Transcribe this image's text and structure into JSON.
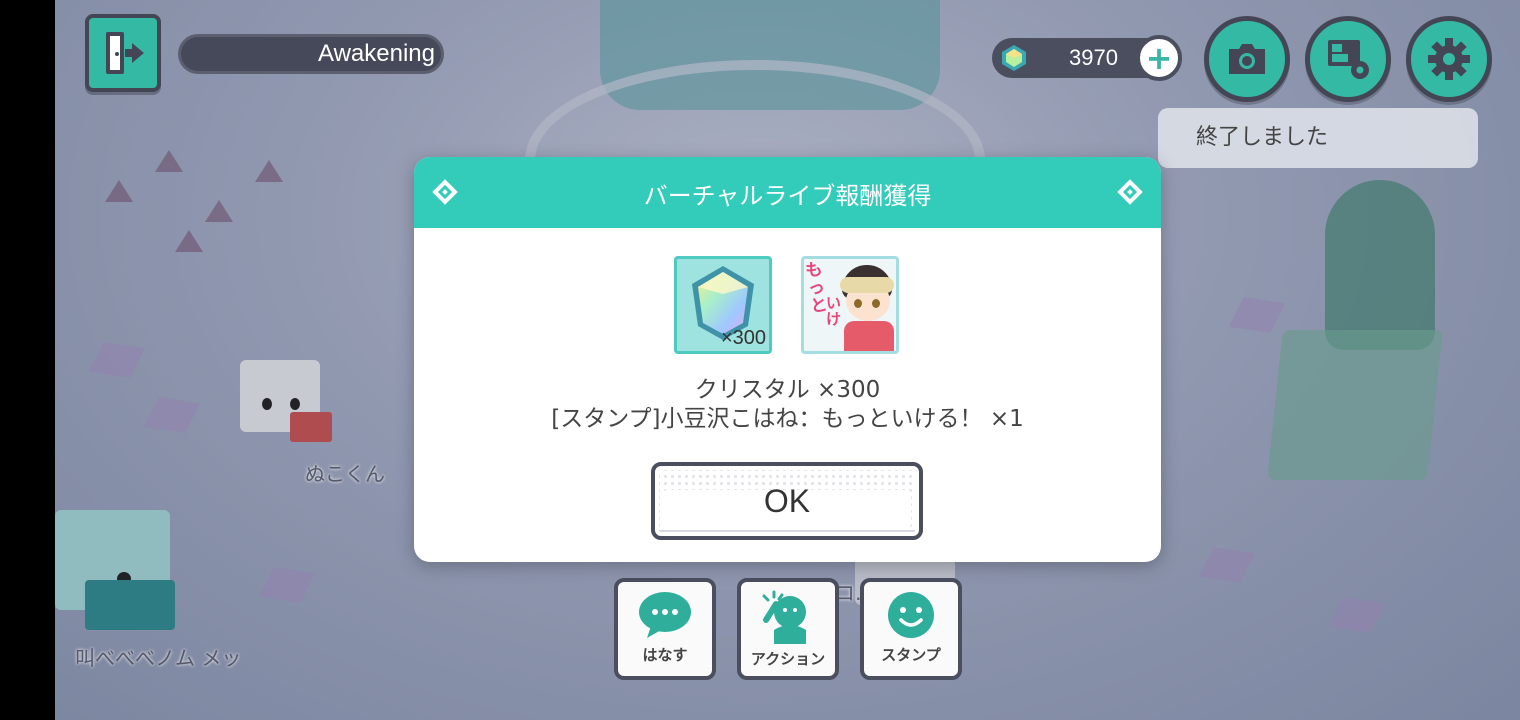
{
  "header": {
    "song_title": "Awakening",
    "crystal_count": "3970",
    "plus_label": "+"
  },
  "notice": "終了しました",
  "players": [
    {
      "name": "ぬこくん"
    },
    {
      "name": "叫べべべノム メッ"
    },
    {
      "name": "コ…きん"
    }
  ],
  "dialog": {
    "title": "バーチャルライブ報酬獲得",
    "rewards": [
      {
        "type": "crystal",
        "qty_label": "×300",
        "icon": "crystal-icon"
      },
      {
        "type": "stamp",
        "icon": "stamp-icon",
        "stamp_text": "もっといける!"
      }
    ],
    "reward_line1": "クリスタル ×300",
    "reward_line2": "[スタンプ]小豆沢こはね：もっといける！ ×1",
    "ok_label": "OK"
  },
  "bottom_bar": {
    "talk_label": "はなす",
    "action_label": "アクション",
    "stamp_label": "スタンプ"
  },
  "colors": {
    "accent": "#33ccbb",
    "button_teal": "#34b9a4",
    "dark_border": "#444656"
  }
}
